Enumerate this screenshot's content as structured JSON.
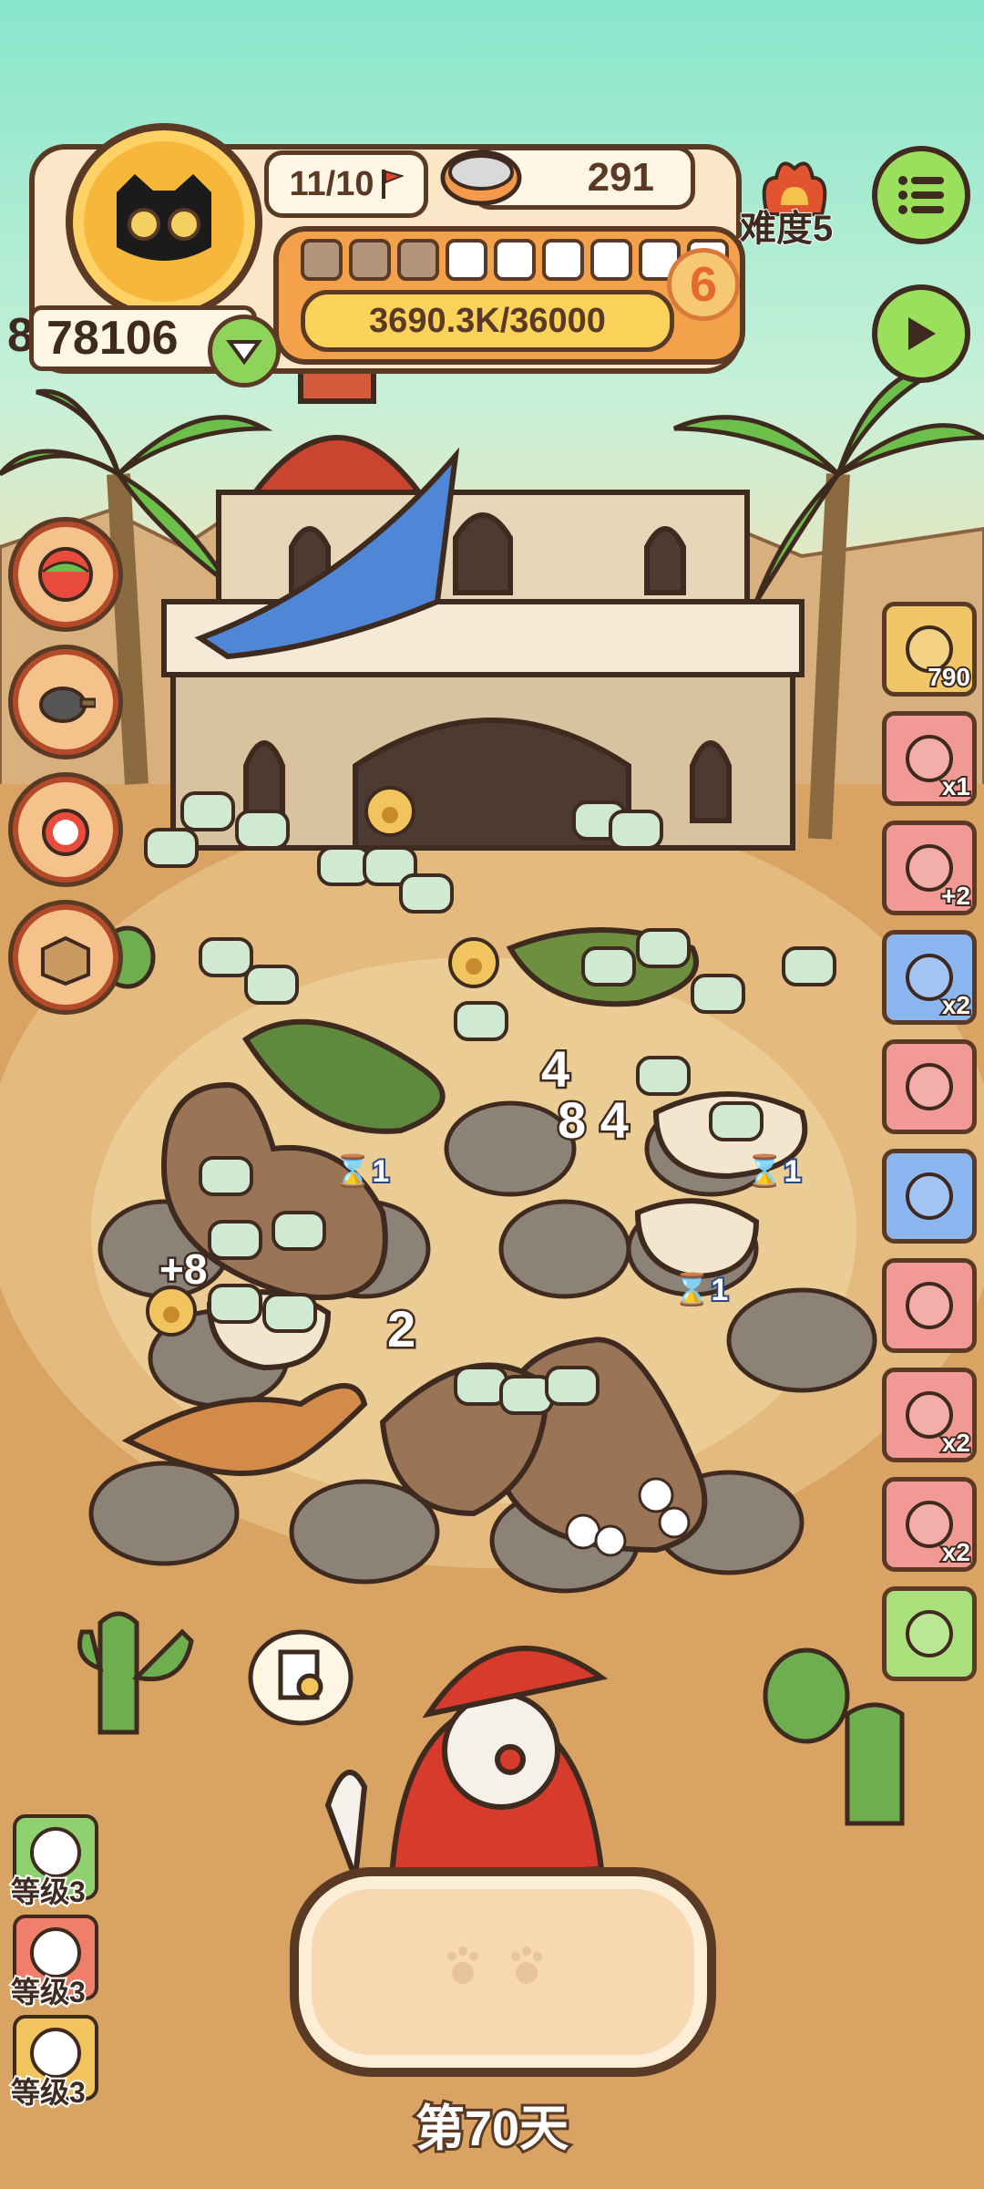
{
  "hud": {
    "stage_progress": "11/10",
    "cat_food": "291",
    "coins": "78106",
    "coins_clipped_digit": "8",
    "level": "6",
    "xp_text": "3690.3K/36000",
    "xp_segments_filled": 3,
    "xp_segments_total": 9,
    "difficulty": "难度5"
  },
  "right_items": [
    {
      "name": "shell-bag-item",
      "count": "790",
      "color": "gold"
    },
    {
      "name": "fish-bait-item",
      "count": "x1",
      "color": "red"
    },
    {
      "name": "paw-coin-bag-item",
      "count": "+2",
      "color": "red"
    },
    {
      "name": "donut-toy-item",
      "count": "x2",
      "color": "blue"
    },
    {
      "name": "fish-skeleton-item",
      "count": "",
      "color": "red"
    },
    {
      "name": "feather-item",
      "count": "",
      "color": "blue"
    },
    {
      "name": "bell-item",
      "count": "",
      "color": "red"
    },
    {
      "name": "crystal-item",
      "count": "x2",
      "color": "red"
    },
    {
      "name": "bomb-item",
      "count": "x2",
      "color": "red"
    },
    {
      "name": "credit-card-item",
      "count": "",
      "color": "green"
    }
  ],
  "level_badges": [
    {
      "label": "等级3",
      "color": "#8fd16e"
    },
    {
      "label": "等级3",
      "color": "#f07f6a"
    },
    {
      "label": "等级3",
      "color": "#f2c45e"
    }
  ],
  "floating": {
    "n4": "4",
    "n84": "8 4",
    "n2": "2",
    "n_plus8": "+8",
    "t1": "1",
    "t2": "1",
    "t3": "1"
  },
  "day_label": "第70天",
  "colors": {
    "sky": "#8ee5c8",
    "sand": "#d9a463",
    "accent_green": "#9ae05c",
    "outline": "#5a3a25"
  }
}
